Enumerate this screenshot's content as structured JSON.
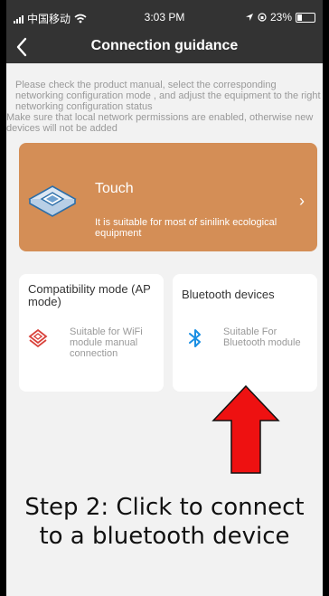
{
  "status_bar": {
    "carrier": "中国移动",
    "time": "3:03 PM",
    "battery": "23%"
  },
  "nav": {
    "title": "Connection guidance"
  },
  "notice": {
    "line1": "Please check the product manual, select the corresponding networking configuration mode , and adjust the equipment to the right networking configuration status",
    "line2": "Make sure that local network permissions are enabled, otherwise new devices will not be added"
  },
  "touch_card": {
    "title": "Touch",
    "description": "It is suitable for most of sinilink ecological equipment"
  },
  "ap_card": {
    "title": "Compatibility mode (AP mode)",
    "description": "Suitable for WiFi module manual connection"
  },
  "bt_card": {
    "title": "Bluetooth devices",
    "description": "Suitable For Bluetooth module"
  },
  "annotation": {
    "line1": "Step 2: Click to connect",
    "line2": "to a bluetooth device"
  },
  "colors": {
    "touch_card": "#d48e56",
    "topbar": "#333333",
    "ap_icon": "#d9423b",
    "bt_icon": "#1a8fe3",
    "arrow": "#ee1111"
  }
}
